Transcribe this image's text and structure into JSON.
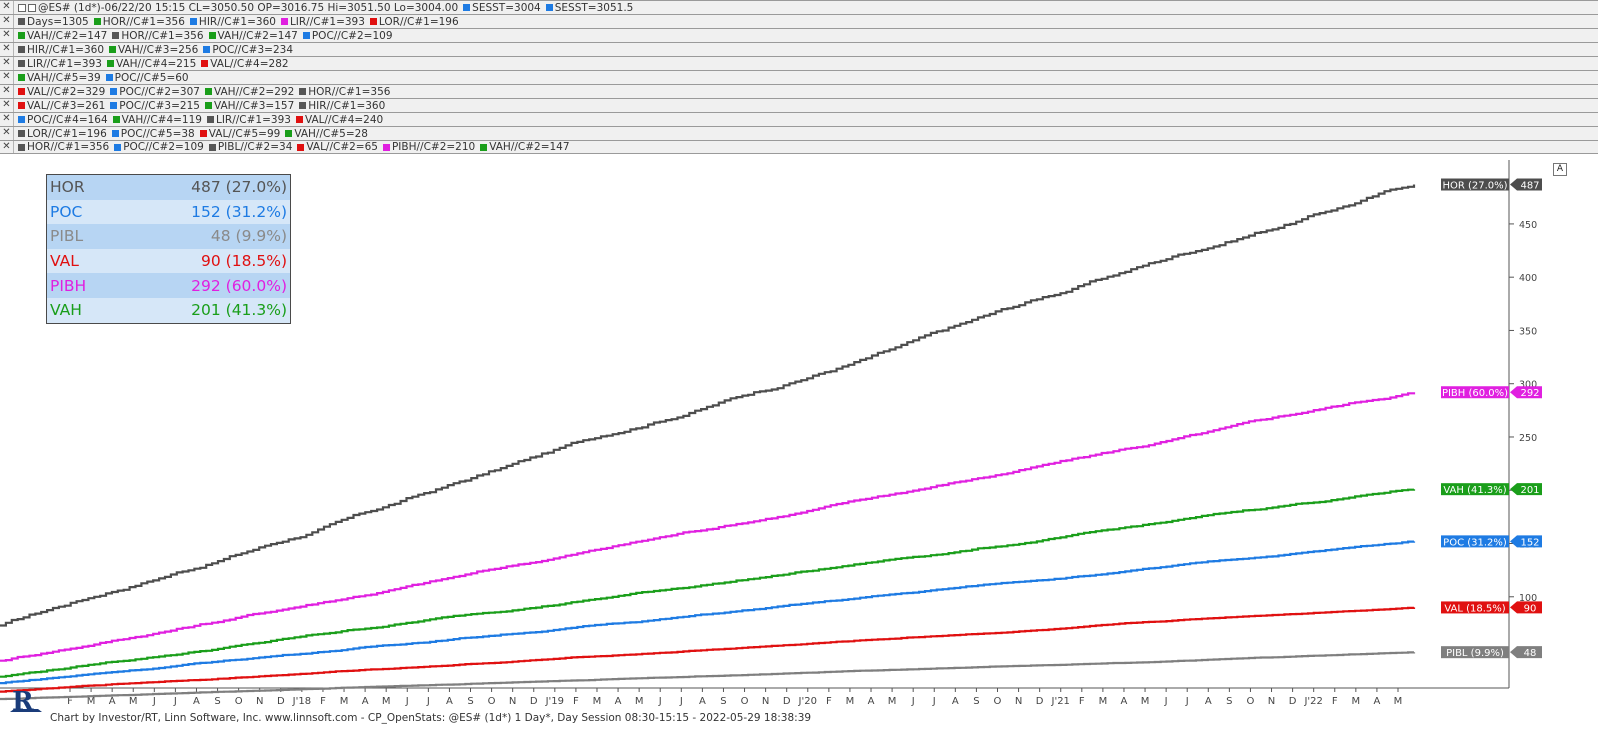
{
  "header_rows": [
    {
      "items": [
        {
          "text": "@ES# (1d*)-06/22/20 15:15 CL=3050.50 OP=3016.75 Hi=3051.50 Lo=3004.00",
          "color": "",
          "toggle": true
        },
        {
          "text": "SESST=3004",
          "color": "#1e7be3"
        },
        {
          "text": "SESST=3051.5",
          "color": "#1e7be3"
        }
      ]
    },
    {
      "items": [
        {
          "text": "Days=1305",
          "color": "#555555"
        },
        {
          "text": "HOR//C#1=356",
          "color": "#1a9e1a"
        },
        {
          "text": "HIR//C#1=360",
          "color": "#1e7be3"
        },
        {
          "text": "LIR//C#1=393",
          "color": "#e020e0"
        },
        {
          "text": "LOR//C#1=196",
          "color": "#e01010"
        }
      ]
    },
    {
      "items": [
        {
          "text": "VAH//C#2=147",
          "color": "#1a9e1a"
        },
        {
          "text": "HOR//C#1=356",
          "color": "#555555"
        },
        {
          "text": "VAH//C#2=147",
          "color": "#1a9e1a"
        },
        {
          "text": "POC//C#2=109",
          "color": "#1e7be3"
        }
      ]
    },
    {
      "items": [
        {
          "text": "HIR//C#1=360",
          "color": "#555555"
        },
        {
          "text": "VAH//C#3=256",
          "color": "#1a9e1a"
        },
        {
          "text": "POC//C#3=234",
          "color": "#1e7be3"
        }
      ]
    },
    {
      "items": [
        {
          "text": "LIR//C#1=393",
          "color": "#555555"
        },
        {
          "text": "VAH//C#4=215",
          "color": "#1a9e1a"
        },
        {
          "text": "VAL//C#4=282",
          "color": "#e01010"
        }
      ]
    },
    {
      "items": [
        {
          "text": "VAH//C#5=39",
          "color": "#1a9e1a"
        },
        {
          "text": "POC//C#5=60",
          "color": "#1e7be3"
        }
      ]
    },
    {
      "items": [
        {
          "text": "VAL//C#2=329",
          "color": "#e01010"
        },
        {
          "text": "POC//C#2=307",
          "color": "#1e7be3"
        },
        {
          "text": "VAH//C#2=292",
          "color": "#1a9e1a"
        },
        {
          "text": "HOR//C#1=356",
          "color": "#555555"
        }
      ]
    },
    {
      "items": [
        {
          "text": "VAL//C#3=261",
          "color": "#e01010"
        },
        {
          "text": "POC//C#3=215",
          "color": "#1e7be3"
        },
        {
          "text": "VAH//C#3=157",
          "color": "#1a9e1a"
        },
        {
          "text": "HIR//C#1=360",
          "color": "#555555"
        }
      ]
    },
    {
      "items": [
        {
          "text": "POC//C#4=164",
          "color": "#1e7be3"
        },
        {
          "text": "VAH//C#4=119",
          "color": "#1a9e1a"
        },
        {
          "text": "LIR//C#1=393",
          "color": "#555555"
        },
        {
          "text": "VAL//C#4=240",
          "color": "#e01010"
        }
      ]
    },
    {
      "items": [
        {
          "text": "LOR//C#1=196",
          "color": "#555555"
        },
        {
          "text": "POC//C#5=38",
          "color": "#1e7be3"
        },
        {
          "text": "VAL//C#5=99",
          "color": "#e01010"
        },
        {
          "text": "VAH//C#5=28",
          "color": "#1a9e1a"
        }
      ]
    },
    {
      "items": [
        {
          "text": "HOR//C#1=356",
          "color": "#555555"
        },
        {
          "text": "POC//C#2=109",
          "color": "#1e7be3"
        },
        {
          "text": "PIBL//C#2=34",
          "color": "#555555"
        },
        {
          "text": "VAL//C#2=65",
          "color": "#e01010"
        },
        {
          "text": "PIBH//C#2=210",
          "color": "#e020e0"
        },
        {
          "text": "VAH//C#2=147",
          "color": "#1a9e1a"
        }
      ]
    }
  ],
  "stats": [
    {
      "name": "HOR",
      "value": "487 (27.0%)",
      "color": "#555555"
    },
    {
      "name": "POC",
      "value": "152 (31.2%)",
      "color": "#1e7be3"
    },
    {
      "name": "PIBL",
      "value": "48 (9.9%)",
      "color": "#8a8a8a"
    },
    {
      "name": "VAL",
      "value": "90 (18.5%)",
      "color": "#e01010"
    },
    {
      "name": "PIBH",
      "value": "292 (60.0%)",
      "color": "#e020e0"
    },
    {
      "name": "VAH",
      "value": "201 (41.3%)",
      "color": "#1a9e1a"
    }
  ],
  "chart_data": {
    "type": "line",
    "ylim": [
      20,
      510
    ],
    "y_ticks": [
      100,
      150,
      200,
      250,
      300,
      350,
      400,
      450
    ],
    "x_labels": [
      "F",
      "M",
      "A",
      "M",
      "J",
      "J",
      "A",
      "S",
      "O",
      "N",
      "D",
      "J'18",
      "F",
      "M",
      "A",
      "M",
      "J",
      "J",
      "A",
      "S",
      "O",
      "N",
      "D",
      "J'19",
      "F",
      "M",
      "A",
      "M",
      "J",
      "J",
      "A",
      "S",
      "O",
      "N",
      "D",
      "J'20",
      "F",
      "M",
      "A",
      "M",
      "J",
      "J",
      "A",
      "S",
      "O",
      "N",
      "D",
      "J'21",
      "F",
      "M",
      "A",
      "M",
      "J",
      "J",
      "A",
      "S",
      "O",
      "N",
      "D",
      "J'22",
      "F",
      "M",
      "A",
      "M"
    ],
    "series": [
      {
        "name": "HOR",
        "label": "HOR (27.0%)",
        "final": "487",
        "color": "#4d4d4d",
        "start": 73,
        "end": 487
      },
      {
        "name": "PIBH",
        "label": "PIBH (60.0%)",
        "final": "292",
        "color": "#e020e0",
        "start": 40,
        "end": 292
      },
      {
        "name": "VAH",
        "label": "VAH (41.3%)",
        "final": "201",
        "color": "#1a9e1a",
        "start": 25,
        "end": 201
      },
      {
        "name": "POC",
        "label": "POC (31.2%)",
        "final": "152",
        "color": "#1e7be3",
        "start": 19,
        "end": 152
      },
      {
        "name": "VAL",
        "label": "VAL (18.5%)",
        "final": "90",
        "color": "#e01010",
        "start": 11,
        "end": 90
      },
      {
        "name": "PIBL",
        "label": "PIBL (9.9%)",
        "final": "48",
        "color": "#7f7f7f",
        "start": 4,
        "end": 48
      }
    ]
  },
  "footer": "Chart by Investor/RT, Linn Software, Inc. www.linnsoft.com - CP_OpenStats: @ES# (1d*) 1 Day*, Day Session 08:30-15:15 - 2022-05-29 18:38:39",
  "auto_label": "A",
  "close_glyph": "✕"
}
